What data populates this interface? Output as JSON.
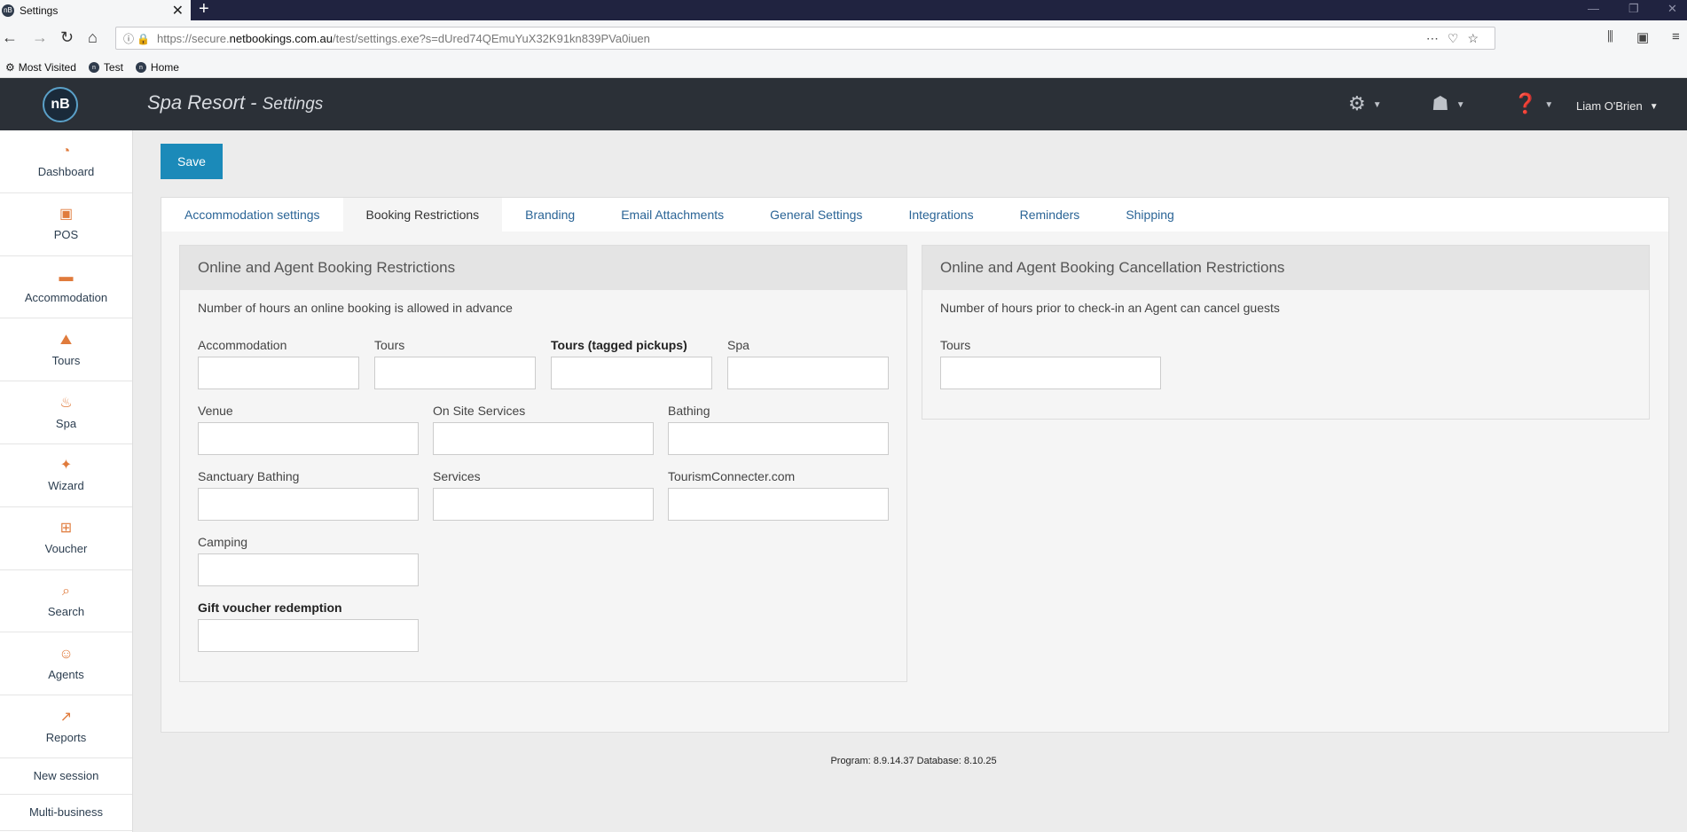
{
  "browser": {
    "tab_title": "Settings",
    "tab_favicon": "nB",
    "url_domain_prefix": "https://secure.",
    "url_domain": "netbookings.com.au",
    "url_path": "/test/settings.exe?s=dUred74QEmuYuX32K91kn839PVa0iuen",
    "bookmarks": [
      {
        "label": "Most Visited",
        "icon": "gear-icon"
      },
      {
        "label": "Test",
        "icon": "nb-favicon"
      },
      {
        "label": "Home",
        "icon": "nb-favicon"
      }
    ]
  },
  "header": {
    "logo": "nB",
    "title": "Spa Resort",
    "separator": " - ",
    "subtitle": "Settings",
    "user_name": "Liam O'Brien"
  },
  "sidebar": {
    "items": [
      {
        "label": "Dashboard",
        "icon": "dashboard-icon"
      },
      {
        "label": "POS",
        "icon": "pos-icon"
      },
      {
        "label": "Accommodation",
        "icon": "bed-icon"
      },
      {
        "label": "Tours",
        "icon": "tours-icon"
      },
      {
        "label": "Spa",
        "icon": "spa-icon"
      },
      {
        "label": "Wizard",
        "icon": "wand-icon"
      },
      {
        "label": "Voucher",
        "icon": "gift-icon"
      },
      {
        "label": "Search",
        "icon": "search-icon"
      },
      {
        "label": "Agents",
        "icon": "agent-icon"
      },
      {
        "label": "Reports",
        "icon": "chart-icon"
      }
    ],
    "links": [
      "New session",
      "Multi-business"
    ]
  },
  "toolbar": {
    "save_label": "Save"
  },
  "tabs": [
    "Accommodation settings",
    "Booking Restrictions",
    "Branding",
    "Email Attachments",
    "General Settings",
    "Integrations",
    "Reminders",
    "Shipping"
  ],
  "active_tab": "Booking Restrictions",
  "online_box": {
    "title": "Online and Agent Booking Restrictions",
    "description": "Number of hours an online booking is allowed in advance",
    "fields": [
      {
        "label": "Accommodation",
        "value": ""
      },
      {
        "label": "Tours",
        "value": ""
      },
      {
        "label": "Tours (tagged pickups)",
        "value": ""
      },
      {
        "label": "Spa",
        "value": ""
      },
      {
        "label": "Venue",
        "value": ""
      },
      {
        "label": "On Site Services",
        "value": ""
      },
      {
        "label": "Bathing",
        "value": ""
      },
      {
        "label": "Sanctuary Bathing",
        "value": ""
      },
      {
        "label": "Services",
        "value": ""
      },
      {
        "label": "TourismConnecter.com",
        "value": ""
      },
      {
        "label": "Camping",
        "value": ""
      },
      {
        "label": "Gift voucher redemption",
        "value": ""
      }
    ]
  },
  "cancel_box": {
    "title": "Online and Agent Booking Cancellation Restrictions",
    "description": "Number of hours prior to check-in an Agent can cancel guests",
    "fields": [
      {
        "label": "Tours",
        "value": ""
      }
    ]
  },
  "footer": {
    "version": "Program: 8.9.14.37 Database: 8.10.25"
  }
}
